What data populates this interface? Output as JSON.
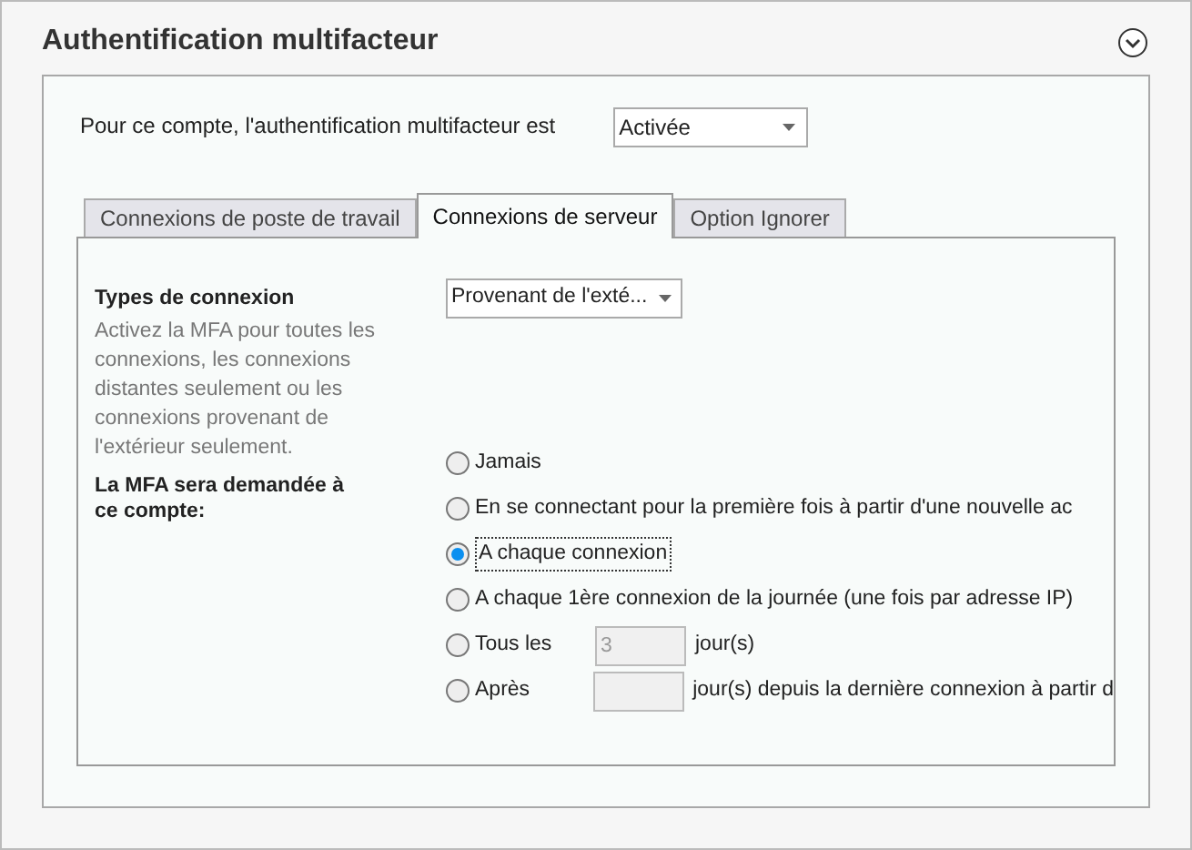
{
  "section": {
    "title": "Authentification multifacteur"
  },
  "mfa_status": {
    "label": "Pour ce compte, l'authentification multifacteur est",
    "value": "Activée"
  },
  "tabs": [
    {
      "label": "Connexions de poste de travail",
      "selected": false
    },
    {
      "label": "Connexions de serveur",
      "selected": true
    },
    {
      "label": "Option Ignorer",
      "selected": false
    }
  ],
  "connection_types": {
    "label": "Types de connexion",
    "description": "Activez la MFA pour toutes les connexions, les connexions distantes seulement ou les connexions provenant de l'extérieur seulement.",
    "value": "Provenant de l'exté..."
  },
  "frequency": {
    "label": "La MFA sera demandée à ce compte:",
    "options": [
      {
        "kind": "plain",
        "label": "Jamais",
        "selected": false
      },
      {
        "kind": "plain",
        "label": "En se connectant pour la première fois à partir d'une nouvelle ac",
        "selected": false
      },
      {
        "kind": "plain",
        "label": "A chaque connexion",
        "selected": true
      },
      {
        "kind": "plain",
        "label": "A chaque 1ère connexion de la journée (une fois par adresse IP)",
        "selected": false
      },
      {
        "kind": "field",
        "label": "Tous les",
        "value": "3",
        "suffix": "jour(s)",
        "selected": false
      },
      {
        "kind": "field",
        "label": "Après",
        "suffix": "jour(s) depuis la dernière connexion à partir d",
        "selected": false
      }
    ]
  }
}
